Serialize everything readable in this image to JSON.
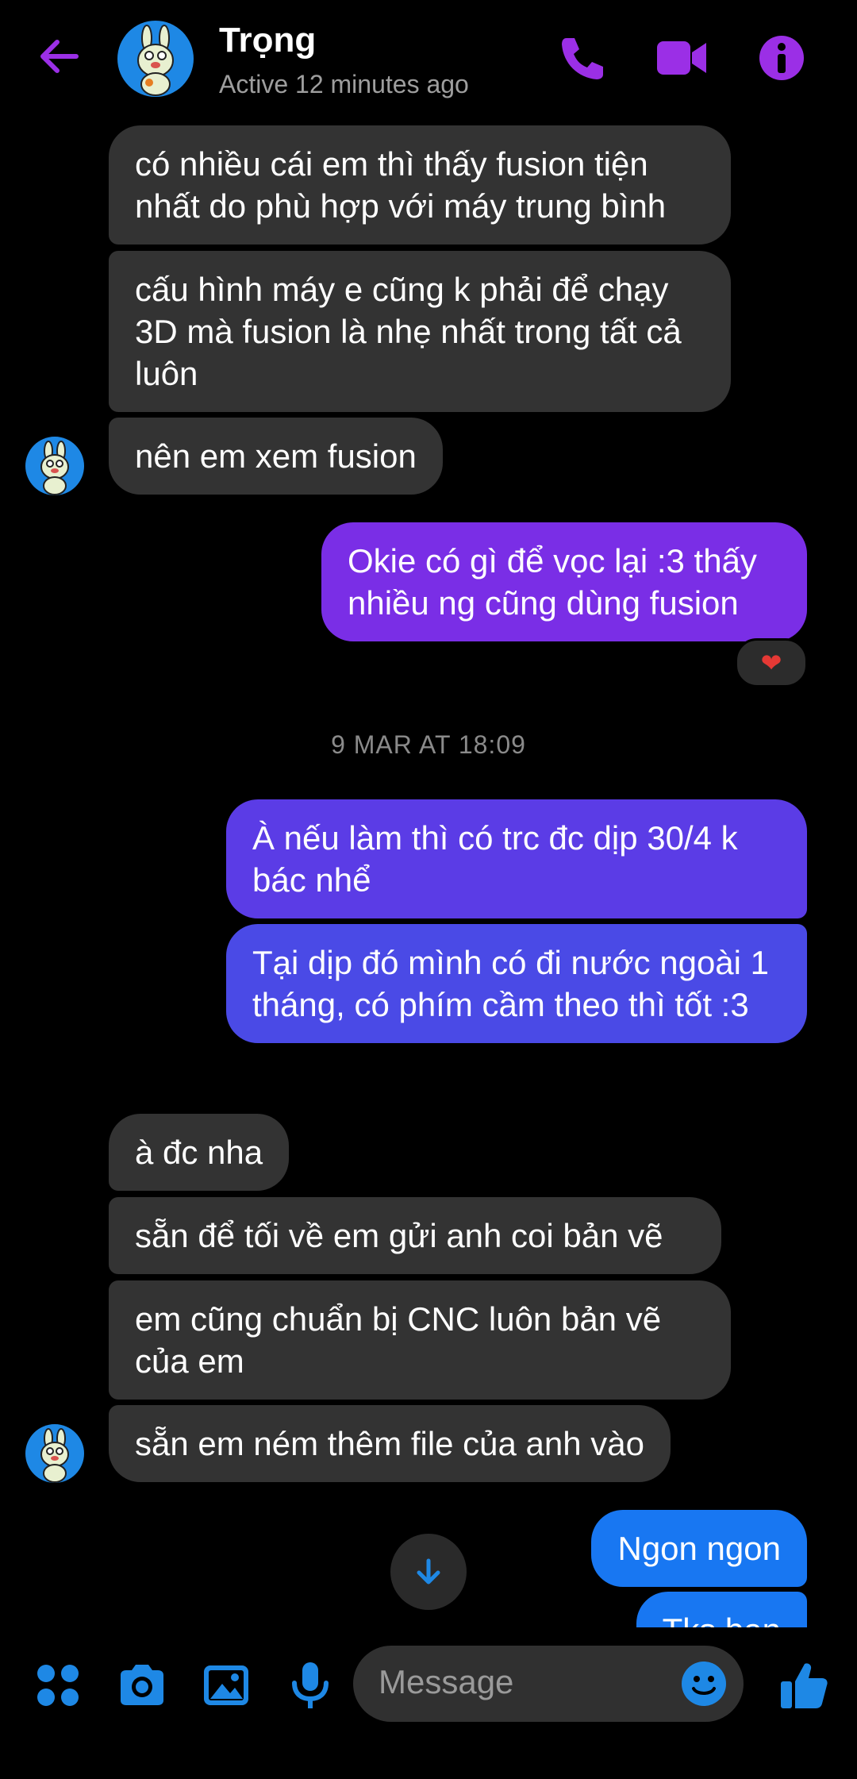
{
  "header": {
    "title": "Trọng",
    "subtitle": "Active 12 minutes ago"
  },
  "messages": {
    "r1": "có nhiều cái em thì thấy fusion tiện nhất do phù hợp với máy trung bình",
    "r2": "cấu hình máy e cũng k phải để chạy 3D mà fusion là nhẹ nhất trong tất cả luôn",
    "r3": "nên em xem fusion",
    "s1": "Okie có gì để vọc lại :3 thấy nhiều ng cũng dùng fusion",
    "reaction": "❤",
    "timestamp": "9 MAR AT 18:09",
    "s2": "À nếu làm thì có trc đc dịp 30/4 k bác nhể",
    "s3": "Tại dịp đó mình có đi nước ngoài 1 tháng, có phím cầm theo thì tốt :3",
    "r4": "à đc nha",
    "r5": "sẵn để tối về em gửi anh coi bản vẽ",
    "r6": "em cũng chuẩn bị CNC luôn bản vẽ của em",
    "r7": "sẵn em ném thêm file của anh vào",
    "s4": "Ngon ngon",
    "s5": "Tks bạn"
  },
  "composer": {
    "placeholder": "Message"
  },
  "colors": {
    "accent_purple": "#8a2be2",
    "accent_blue": "#1877f2",
    "received_bubble": "#333333"
  }
}
